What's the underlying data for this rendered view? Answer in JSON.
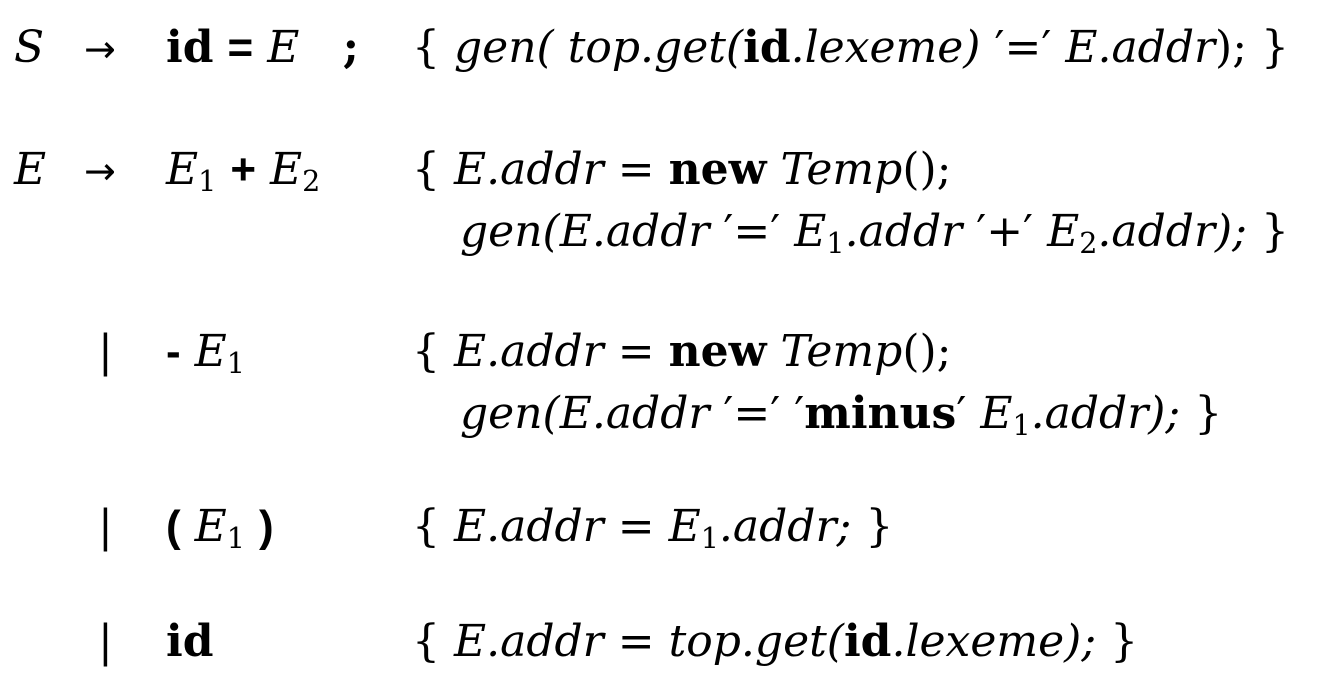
{
  "grammar": {
    "rows": [
      {
        "lhs": "S",
        "arrow": "→",
        "rhs": {
          "id": "id",
          "eq": "=",
          "E": "E",
          "semi": ";"
        },
        "action": {
          "open": "{",
          "gen": "gen(",
          "top": "top.get(",
          "id": "id",
          "lexeme": ".lexeme)",
          "quote_eq": "′=′",
          "addr": "E.addr",
          "tail": ");",
          "close": "}"
        }
      },
      {
        "lhs": "E",
        "arrow": "→",
        "rhs": {
          "E1": "E",
          "sub1": "1",
          "plus": "+",
          "E2": "E",
          "sub2": "2"
        },
        "action_line1": {
          "open": "{",
          "addr": "E.addr",
          "eq": "=",
          "new": "new",
          "temp": "Temp",
          "call": "();"
        },
        "action_line2": {
          "gen": "gen(E.addr",
          "quote_eq": "′=′",
          "E1": "E",
          "sub1": "1",
          "addr1": ".addr",
          "quote_plus": "′+′",
          "E2": "E",
          "sub2": "2",
          "addr2": ".addr);",
          "close": "}"
        }
      },
      {
        "bar": "|",
        "rhs": {
          "minus": "-",
          "E1": "E",
          "sub1": "1"
        },
        "action_line1": {
          "open": "{",
          "addr": "E.addr",
          "eq": "=",
          "new": "new",
          "temp": "Temp",
          "call": "();"
        },
        "action_line2": {
          "gen": "gen(E.addr",
          "quote_eq": "′=′",
          "q_open": "′",
          "minus_word": "minus",
          "q_close": "′",
          "E1": "E",
          "sub1": "1",
          "addr1": ".addr);",
          "close": "}"
        }
      },
      {
        "bar": "|",
        "rhs": {
          "lparen": "(",
          "E1": "E",
          "sub1": "1",
          "rparen": ")"
        },
        "action": {
          "open": "{",
          "addr": "E.addr",
          "eq": "=",
          "E1": "E",
          "sub1": "1",
          "addr1": ".addr;",
          "close": "}"
        }
      },
      {
        "bar": "|",
        "rhs": {
          "id": "id"
        },
        "action": {
          "open": "{",
          "addr": "E.addr",
          "eq": "=",
          "top": "top.get(",
          "id": "id",
          "lexeme": ".lexeme);",
          "close": "}"
        }
      }
    ]
  }
}
